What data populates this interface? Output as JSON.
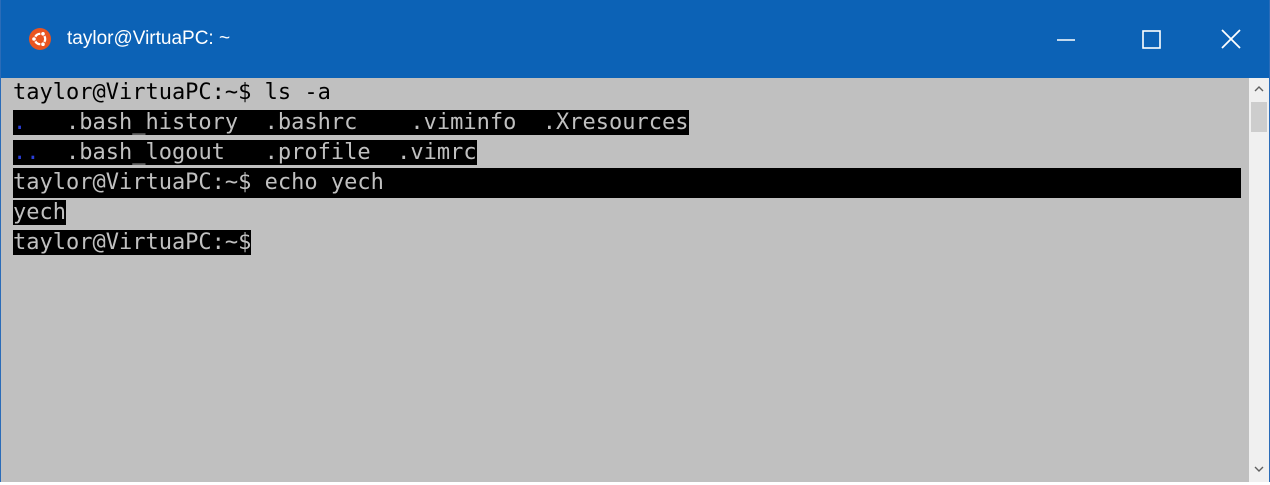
{
  "window": {
    "title": "taylor@VirtuaPC: ~",
    "app_icon": "ubuntu-logo-icon",
    "titlebar_color": "#0c62b6",
    "terminal_bg": "#c0c0c0",
    "highlight_bg": "#000000",
    "directory_color": "#2a3fd8",
    "controls": {
      "minimize_icon": "minimize-icon",
      "maximize_icon": "maximize-icon",
      "close_icon": "close-icon"
    }
  },
  "terminal": {
    "line1": {
      "prompt": "taylor@VirtuaPC:~$",
      "command": " ls -a"
    },
    "line2": {
      "dir": ".",
      "rest": "   .bash_history  .bashrc    .viminfo  .Xresources"
    },
    "line3": {
      "dir": "..",
      "rest": "  .bash_logout   .profile  .vimrc"
    },
    "line4": {
      "prompt": "taylor@VirtuaPC:~$",
      "command": " echo yech"
    },
    "line5": {
      "output": "yech"
    },
    "line6": {
      "prompt": "taylor@VirtuaPC:~$"
    }
  },
  "scrollbar": {
    "up_icon": "scroll-up-arrow-icon",
    "down_icon": "scroll-down-arrow-icon"
  }
}
